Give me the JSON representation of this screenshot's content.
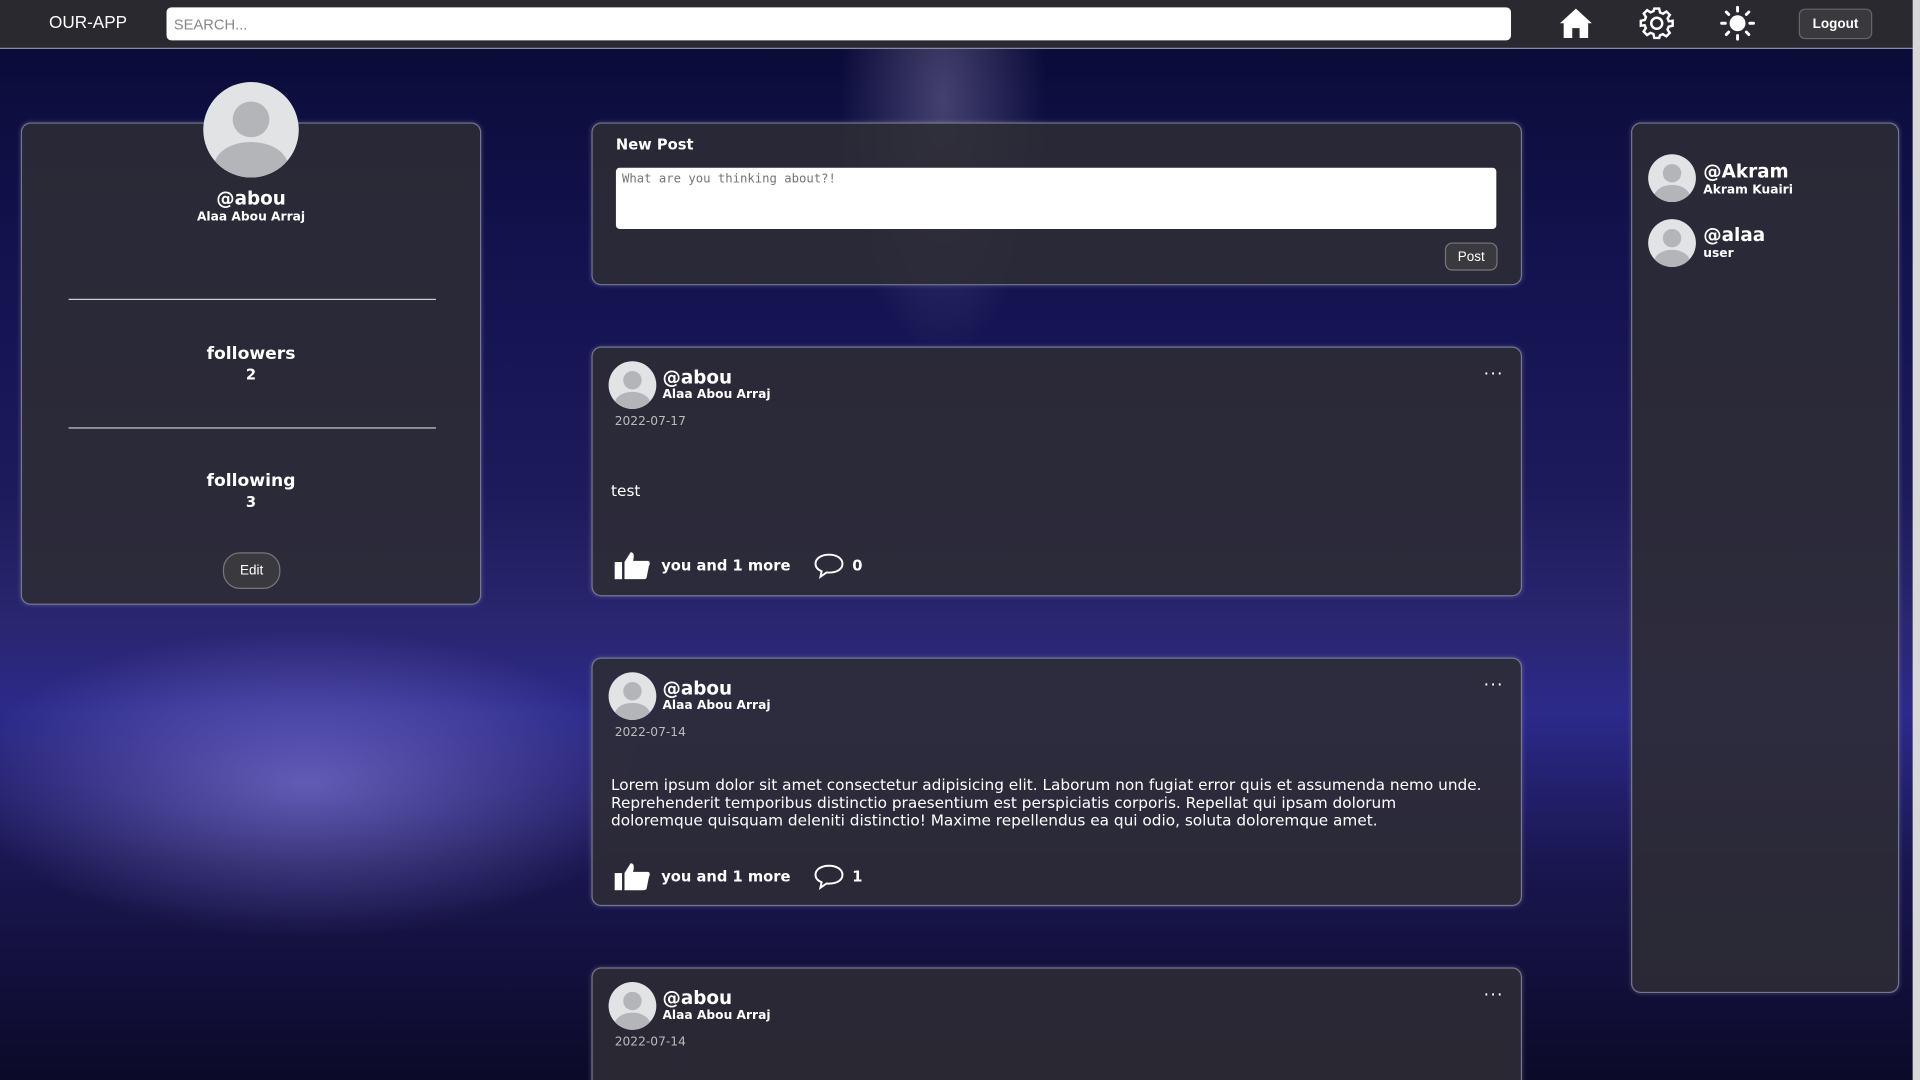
{
  "header": {
    "logo": "OUR-APP",
    "search_placeholder": "SEARCH...",
    "logout": "Logout",
    "icons": [
      "home-icon",
      "gear-icon",
      "sun-icon"
    ]
  },
  "profile": {
    "username": "@abou",
    "fullname": "Alaa Abou Arraj",
    "followers_label": "followers",
    "followers": "2",
    "following_label": "following",
    "following": "3",
    "edit": "Edit"
  },
  "new_post": {
    "title": "New Post",
    "placeholder": "What are you thinking about?!",
    "submit": "Post"
  },
  "posts": [
    {
      "username": "@abou",
      "fullname": "Alaa Abou Arraj",
      "date": "2022-07-17",
      "body": "test",
      "likes": "you and 1 more",
      "comments": "0"
    },
    {
      "username": "@abou",
      "fullname": "Alaa Abou Arraj",
      "date": "2022-07-14",
      "body": "Lorem ipsum dolor sit amet consectetur adipisicing elit. Laborum non fugiat error quis et assumenda nemo unde. Reprehenderit temporibus distinctio praesentium est perspiciatis corporis. Repellat qui ipsam dolorum doloremque quisquam deleniti distinctio! Maxime repellendus ea qui odio, soluta doloremque amet.",
      "likes": "you and 1 more",
      "comments": "1"
    },
    {
      "username": "@abou",
      "fullname": "Alaa Abou Arraj",
      "date": "2022-07-14"
    }
  ],
  "users": [
    {
      "username": "@Akram",
      "sub": "Akram Kuairi"
    },
    {
      "username": "@alaa",
      "sub": "user"
    }
  ]
}
